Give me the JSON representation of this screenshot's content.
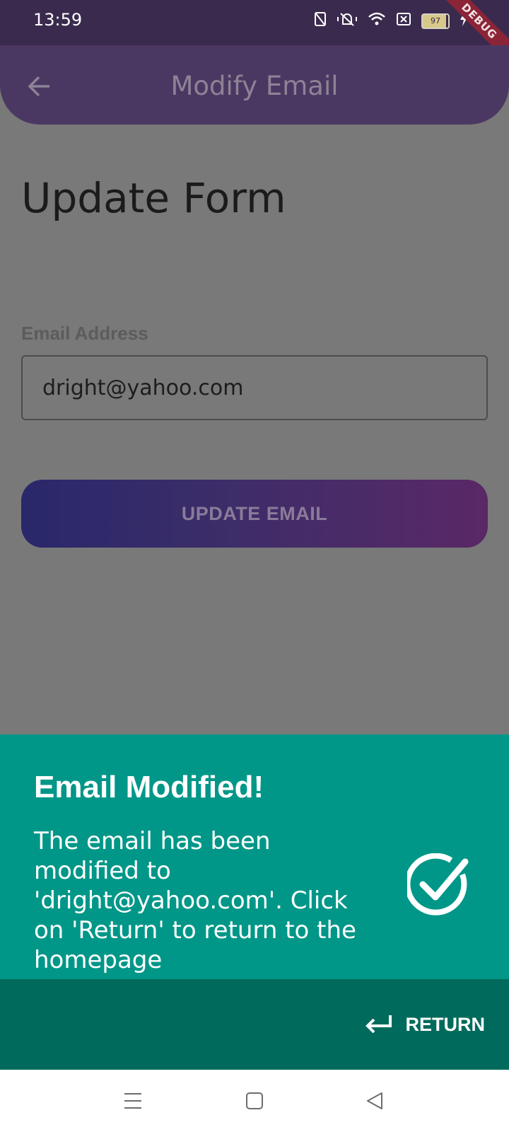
{
  "status_bar": {
    "time": "13:59",
    "battery": "97",
    "debug_label": "DEBUG",
    "icons": [
      "nfc-icon",
      "vibrate-icon",
      "wifi-icon",
      "sim-icon",
      "battery-icon",
      "charging-icon"
    ]
  },
  "app_bar": {
    "title": "Modify Email",
    "back_icon": "arrow-left-icon"
  },
  "form": {
    "heading": "Update Form",
    "email_label": "Email Address",
    "email_value": "dright@yahoo.com",
    "update_button": "UPDATE EMAIL"
  },
  "snackbar": {
    "title": "Email Modified!",
    "message": "The email has been modified to 'dright@yahoo.com'. Click on 'Return' to return to the homepage",
    "icon": "check-circle-icon",
    "action_label": "RETURN",
    "action_icon": "return-arrow-icon"
  },
  "nav_bar": {
    "icons": [
      "menu-icon",
      "home-icon",
      "back-icon"
    ]
  },
  "colors": {
    "status_bar": "#3a2b4e",
    "app_bar": "#4b3862",
    "snackbar": "#009788",
    "snackbar_footer": "#006b5c"
  }
}
